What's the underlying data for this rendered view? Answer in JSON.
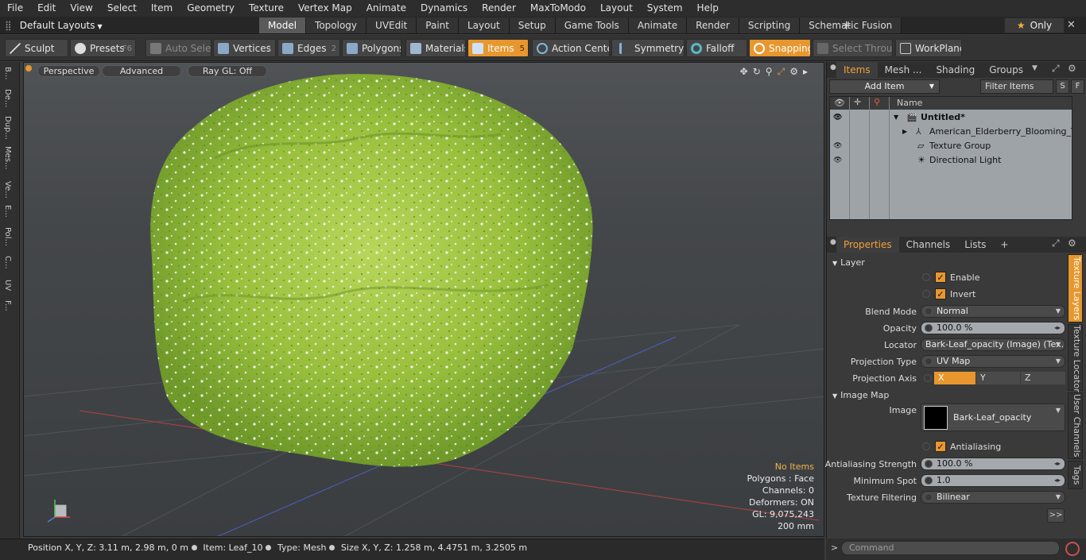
{
  "menu": [
    "File",
    "Edit",
    "View",
    "Select",
    "Item",
    "Geometry",
    "Texture",
    "Vertex Map",
    "Animate",
    "Dynamics",
    "Render",
    "MaxToModo",
    "Layout",
    "System",
    "Help"
  ],
  "layouts": {
    "label": "Default Layouts"
  },
  "tabs": [
    "Model",
    "Topology",
    "UVEdit",
    "Paint",
    "Layout",
    "Setup",
    "Game Tools",
    "Animate",
    "Render",
    "Scripting",
    "Schematic Fusion"
  ],
  "active_tab": "Model",
  "tab_plus": "+",
  "only_label": "Only",
  "toolbar": {
    "sculpt": "Sculpt",
    "presets": "Presets",
    "presets_key": "F6",
    "auto_select": "Auto Select",
    "vertices": "Vertices",
    "vertices_n": "1",
    "edges": "Edges",
    "edges_n": "2",
    "polygons": "Polygons",
    "materials": "Materials",
    "items": "Items",
    "items_n": "5",
    "action_center": "Action Center",
    "symmetry": "Symmetry",
    "falloff": "Falloff",
    "snapping": "Snapping",
    "select_through": "Select Through",
    "workplane": "WorkPlane"
  },
  "left_tabs": [
    "B...",
    "De...",
    "Dup...",
    "Mes...",
    "Ve...",
    "E...",
    "Pol...",
    "C...",
    "UV",
    "F..."
  ],
  "viewport": {
    "perspective": "Perspective",
    "advanced": "Advanced",
    "raygl": "Ray GL: Off",
    "no_items": "No Items",
    "polygons": "Polygons : Face",
    "channels": "Channels: 0",
    "deformers": "Deformers: ON",
    "gl": "GL: 9,075,243",
    "scale": "200 mm"
  },
  "status": {
    "position": "Position X, Y, Z:  3.11 m, 2.98 m, 0 m",
    "item": "Item:  Leaf_10",
    "type": "Type:  Mesh",
    "size": "Size X, Y, Z:  1.258 m, 4.4751 m, 3.2505 m"
  },
  "items_panel": {
    "tabs": [
      "Items",
      "Mesh ...",
      "Shading",
      "Groups"
    ],
    "add_item": "Add Item",
    "filter": "Filter Items",
    "s": "S",
    "f": "F",
    "name_col": "Name",
    "rows": [
      "Untitled*",
      "American_Elderberry_Blooming_Tr...",
      "Texture Group",
      "Directional Light"
    ]
  },
  "props_panel": {
    "tabs": [
      "Properties",
      "Channels",
      "Lists",
      "+"
    ],
    "layer": "Layer",
    "enable": "Enable",
    "invert": "Invert",
    "blend_mode_l": "Blend Mode",
    "blend_mode": "Normal",
    "opacity_l": "Opacity",
    "opacity": "100.0 %",
    "locator_l": "Locator",
    "locator": "Bark-Leaf_opacity (Image) (Tex...",
    "proj_type_l": "Projection Type",
    "proj_type": "UV Map",
    "proj_axis_l": "Projection Axis",
    "ax_x": "X",
    "ax_y": "Y",
    "ax_z": "Z",
    "image_map": "Image Map",
    "image_l": "Image",
    "image": "Bark-Leaf_opacity",
    "antialiasing": "Antialiasing",
    "aa_strength_l": "Antialiasing Strength",
    "aa_strength": "100.0 %",
    "min_spot_l": "Minimum Spot",
    "min_spot": "1.0",
    "tex_filter_l": "Texture Filtering",
    "tex_filter": "Bilinear",
    "more": ">>"
  },
  "right_vtabs": [
    "Texture Layers",
    "Texture Locator",
    "User Channels",
    "Tags"
  ],
  "command_placeholder": "Command",
  "colors": {
    "accent": "#e8972f",
    "foliage": "#9bc43c",
    "trunk": "#7a6a48"
  }
}
